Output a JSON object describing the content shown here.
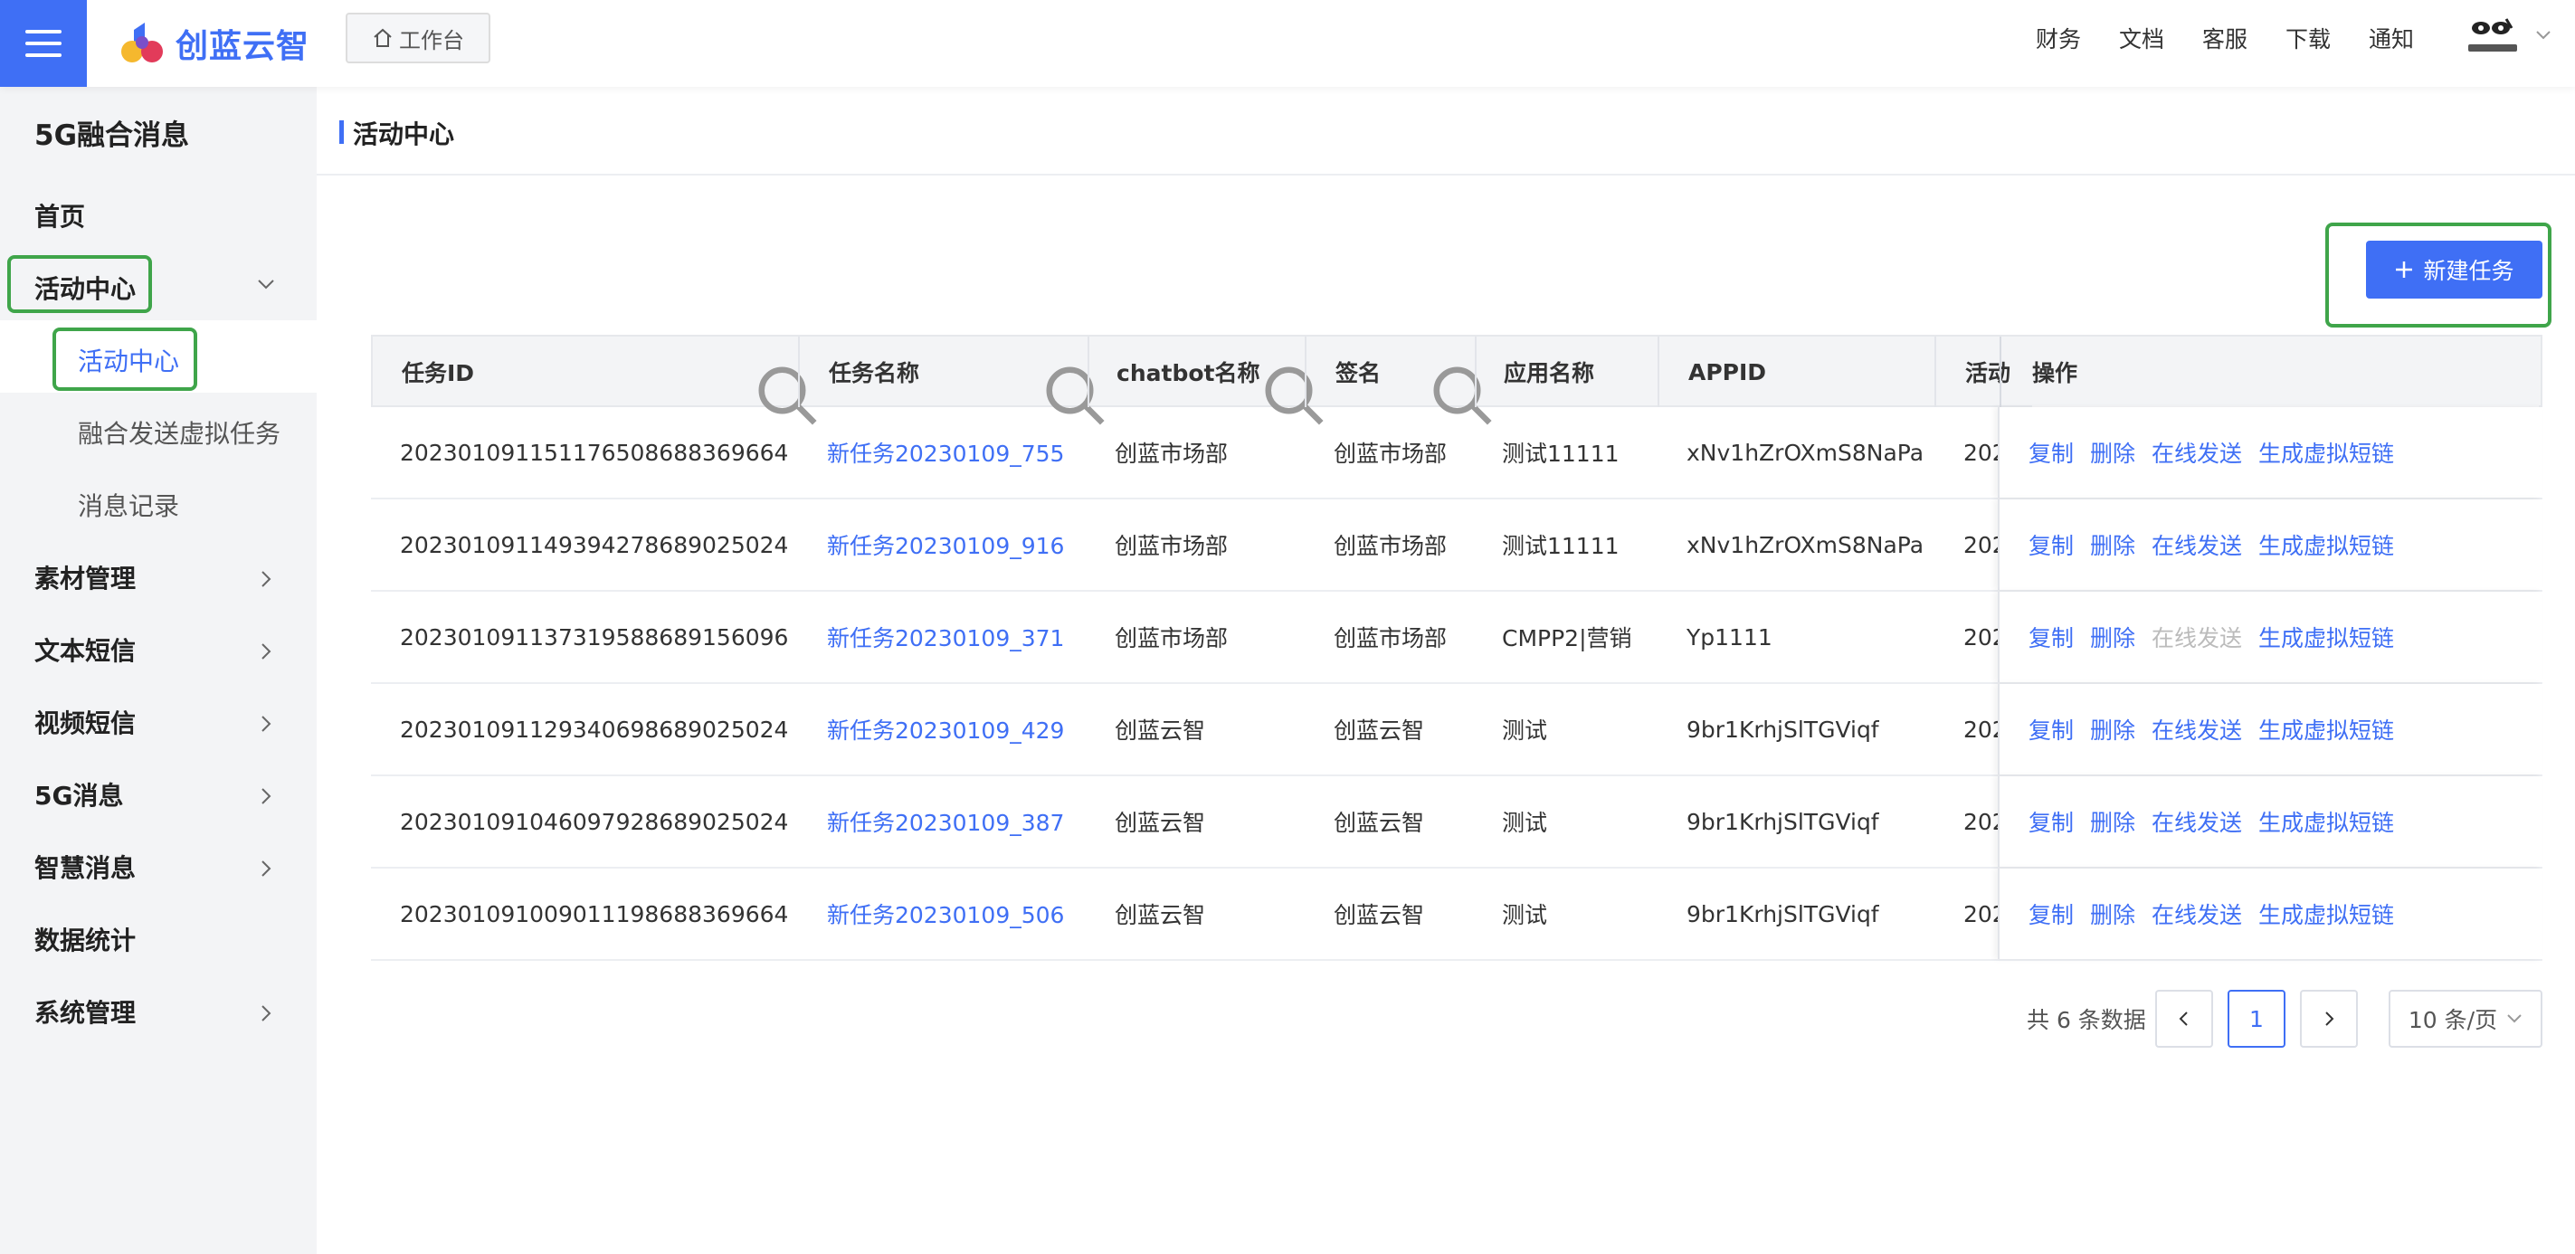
{
  "topbar": {
    "logo_text": "创蓝云智",
    "workbench_label": "工作台",
    "nav": [
      "财务",
      "文档",
      "客服",
      "下载",
      "通知"
    ]
  },
  "sidebar": {
    "title": "5G融合消息",
    "items": [
      {
        "label": "首页"
      },
      {
        "label": "活动中心",
        "expanded": true,
        "children": [
          "活动中心",
          "融合发送虚拟任务",
          "消息记录"
        ]
      },
      {
        "label": "素材管理"
      },
      {
        "label": "文本短信"
      },
      {
        "label": "视频短信"
      },
      {
        "label": "5G消息"
      },
      {
        "label": "智慧消息"
      },
      {
        "label": "数据统计"
      },
      {
        "label": "系统管理"
      }
    ]
  },
  "main": {
    "title": "活动中心",
    "new_task_label": "新建任务",
    "columns": [
      "任务ID",
      "任务名称",
      "chatbot名称",
      "签名",
      "应用名称",
      "APPID",
      "活动",
      "操作"
    ],
    "rows": [
      {
        "id": "2023010911511765086883696​64",
        "name": "新任务20230109_755",
        "chatbot": "创蓝市场部",
        "sign": "创蓝市场部",
        "app": "测试11111",
        "appid": "xNv1hZrOXmS8NaPa",
        "act": "202"
      },
      {
        "id": "20230109114939427868902​5024",
        "name": "新任务20230109_916",
        "chatbot": "创蓝市场部",
        "sign": "创蓝市场部",
        "app": "测试11111",
        "appid": "xNv1hZrOXmS8NaPa",
        "act": "202"
      },
      {
        "id": "20230109113731958868915​6096",
        "name": "新任务20230109_371",
        "chatbot": "创蓝市场部",
        "sign": "创蓝市场部",
        "app": "CMPP2|营销",
        "appid": "Yp1111",
        "act": "202"
      },
      {
        "id": "20230109112934069868902​5024",
        "name": "新任务20230109_429",
        "chatbot": "创蓝云智",
        "sign": "创蓝云智",
        "app": "测试",
        "appid": "9br1KrhjSlTGViqf",
        "act": "202"
      },
      {
        "id": "20230109104609792868902​5024",
        "name": "新任务20230109_387",
        "chatbot": "创蓝云智",
        "sign": "创蓝云智",
        "app": "测试",
        "appid": "9br1KrhjSlTGViqf",
        "act": "202"
      },
      {
        "id": "20230109100901119868836​9664",
        "name": "新任务20230109_506",
        "chatbot": "创蓝云智",
        "sign": "创蓝云智",
        "app": "测试",
        "appid": "9br1KrhjSlTGViqf",
        "act": "202"
      }
    ],
    "ops": [
      "复制",
      "删除",
      "在线发送",
      "生成虚拟短链"
    ],
    "ops_disabled_row": 2,
    "pagination": {
      "total_text": "共 6 条数据",
      "current_page": "1",
      "page_size": "10 条/页"
    }
  },
  "colors": {
    "primary": "#3f6ff5",
    "highlight": "#3fa54a"
  }
}
